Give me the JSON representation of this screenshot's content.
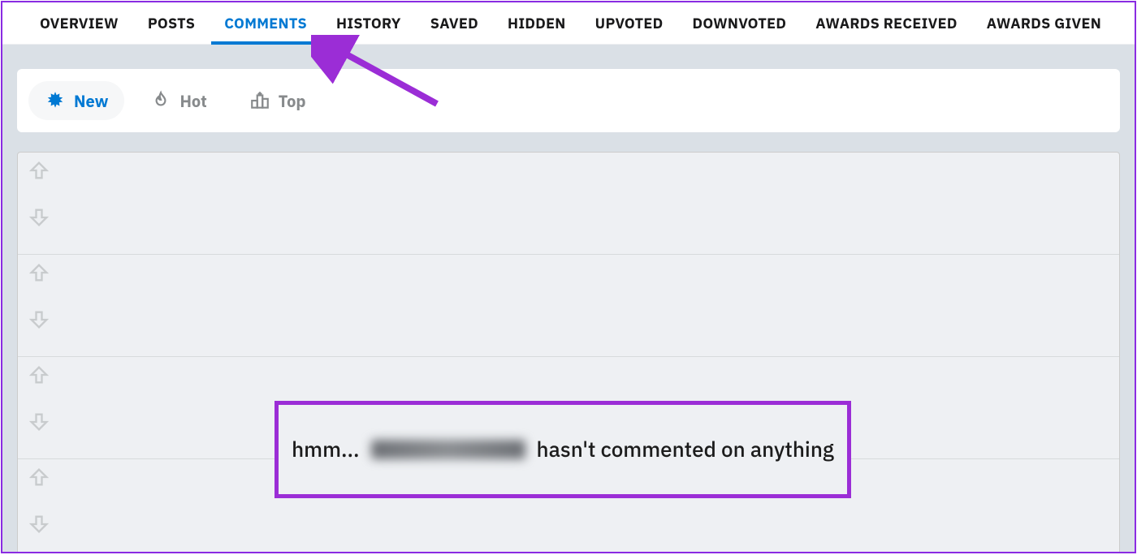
{
  "tabs": [
    {
      "id": "overview",
      "label": "OVERVIEW",
      "active": false
    },
    {
      "id": "posts",
      "label": "POSTS",
      "active": false
    },
    {
      "id": "comments",
      "label": "COMMENTS",
      "active": true
    },
    {
      "id": "history",
      "label": "HISTORY",
      "active": false
    },
    {
      "id": "saved",
      "label": "SAVED",
      "active": false
    },
    {
      "id": "hidden",
      "label": "HIDDEN",
      "active": false
    },
    {
      "id": "upvoted",
      "label": "UPVOTED",
      "active": false
    },
    {
      "id": "downvoted",
      "label": "DOWNVOTED",
      "active": false
    },
    {
      "id": "awards-received",
      "label": "AWARDS RECEIVED",
      "active": false
    },
    {
      "id": "awards-given",
      "label": "AWARDS GIVEN",
      "active": false
    }
  ],
  "sort": [
    {
      "id": "new",
      "label": "New",
      "active": true,
      "icon": "burst"
    },
    {
      "id": "hot",
      "label": "Hot",
      "active": false,
      "icon": "flame"
    },
    {
      "id": "top",
      "label": "Top",
      "active": false,
      "icon": "podium"
    }
  ],
  "empty_state": {
    "prefix": "hmm...",
    "suffix": "hasn't commented on anything"
  },
  "colors": {
    "accent": "#0079d3",
    "annotation": "#9b2dd6"
  }
}
